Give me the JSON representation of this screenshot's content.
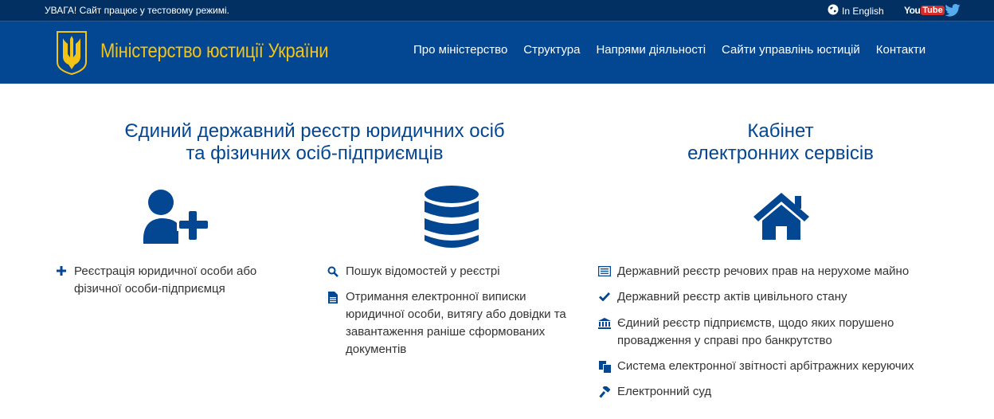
{
  "topbar": {
    "notice": "УВАГА! Сайт працює у тестовому режимі.",
    "language_link": "In English",
    "youtube_you": "You",
    "youtube_tube": "Tube"
  },
  "header": {
    "site_title": "Міністерство юстиції України",
    "nav": [
      "Про міністерство",
      "Структура",
      "Напрями діяльності",
      "Сайти управлінь юстицій",
      "Контакти"
    ]
  },
  "sections": {
    "registry": {
      "title_line1": "Єдиний державний реєстр юридичних осіб",
      "title_line2": "та фізичних осіб-підприємців",
      "register_item": "Реєстрація юридичної особи або фізичної особи-підприємця",
      "search_item": "Пошук відомостей у реєстрі",
      "extract_item": "Отримання електронної виписки юридичної особи, витягу або довідки та завантаження раніше сформованих документів"
    },
    "cabinet": {
      "title_line1": "Кабінет",
      "title_line2": "електронних сервісів",
      "items": [
        "Державний реєстр речових прав на нерухоме майно",
        "Державний реєстр актів цивільного стану",
        "Єдиний реєстр підприємств, щодо яких порушено провадження у справі про банкрутство",
        "Система електронної звітності арбітражних керуючих",
        "Електронний суд"
      ]
    }
  },
  "colors": {
    "topbar_bg": "#033063",
    "header_bg": "#034691",
    "title_gold": "#f3c316",
    "accent_blue": "#034691"
  }
}
